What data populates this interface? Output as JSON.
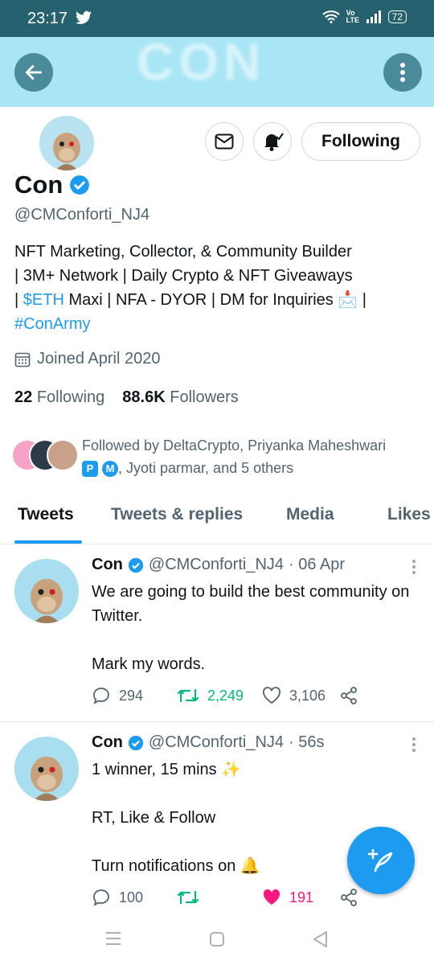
{
  "status_bar": {
    "time": "23:17",
    "network": "Vo LTE",
    "battery": "72"
  },
  "banner": {
    "ghost_text": "CON"
  },
  "profile": {
    "name": "Con",
    "handle": "@CMConforti_NJ4",
    "following_button": "Following",
    "bio_line1": "NFT Marketing, Collector, & Community Builder",
    "bio_line2": "| 3M+ Network | Daily Crypto & NFT Giveaways",
    "bio_pipe": "| ",
    "bio_cashtag": "$ETH",
    "bio_line3_rest": " Maxi | NFA - DYOR | DM for Inquiries 📩 |",
    "bio_hashtag": "#ConArmy",
    "joined": "Joined April 2020",
    "following_count": "22",
    "following_label": "Following",
    "followers_count": "88.6K",
    "followers_label": "Followers",
    "followed_by_line1": "Followed by DeltaCrypto, Priyanka Maheshwari",
    "followed_by_badge1": "P",
    "followed_by_badge2": "M",
    "followed_by_line2": ", Jyoti parmar, and 5 others"
  },
  "tabs": [
    "Tweets",
    "Tweets & replies",
    "Media",
    "Likes"
  ],
  "tweets": [
    {
      "name": "Con",
      "handle": "@CMConforti_NJ4",
      "time": "· 06 Apr",
      "body": [
        "We are going to build the best community on Twitter.",
        "Mark my words."
      ],
      "replies": "294",
      "retweets": "2,249",
      "likes": "3,106"
    },
    {
      "name": "Con",
      "handle": "@CMConforti_NJ4",
      "time": "· 56s",
      "body": [
        "1 winner, 15 mins ✨",
        "RT, Like & Follow",
        "Turn notifications on 🔔"
      ],
      "replies": "100",
      "retweets": "",
      "likes": "191"
    }
  ],
  "colors": {
    "brand": "#1d9bf0",
    "retweet": "#00ba7c",
    "like": "#f91880",
    "status_bar": "#25616f",
    "banner": "#a9e6f5"
  }
}
